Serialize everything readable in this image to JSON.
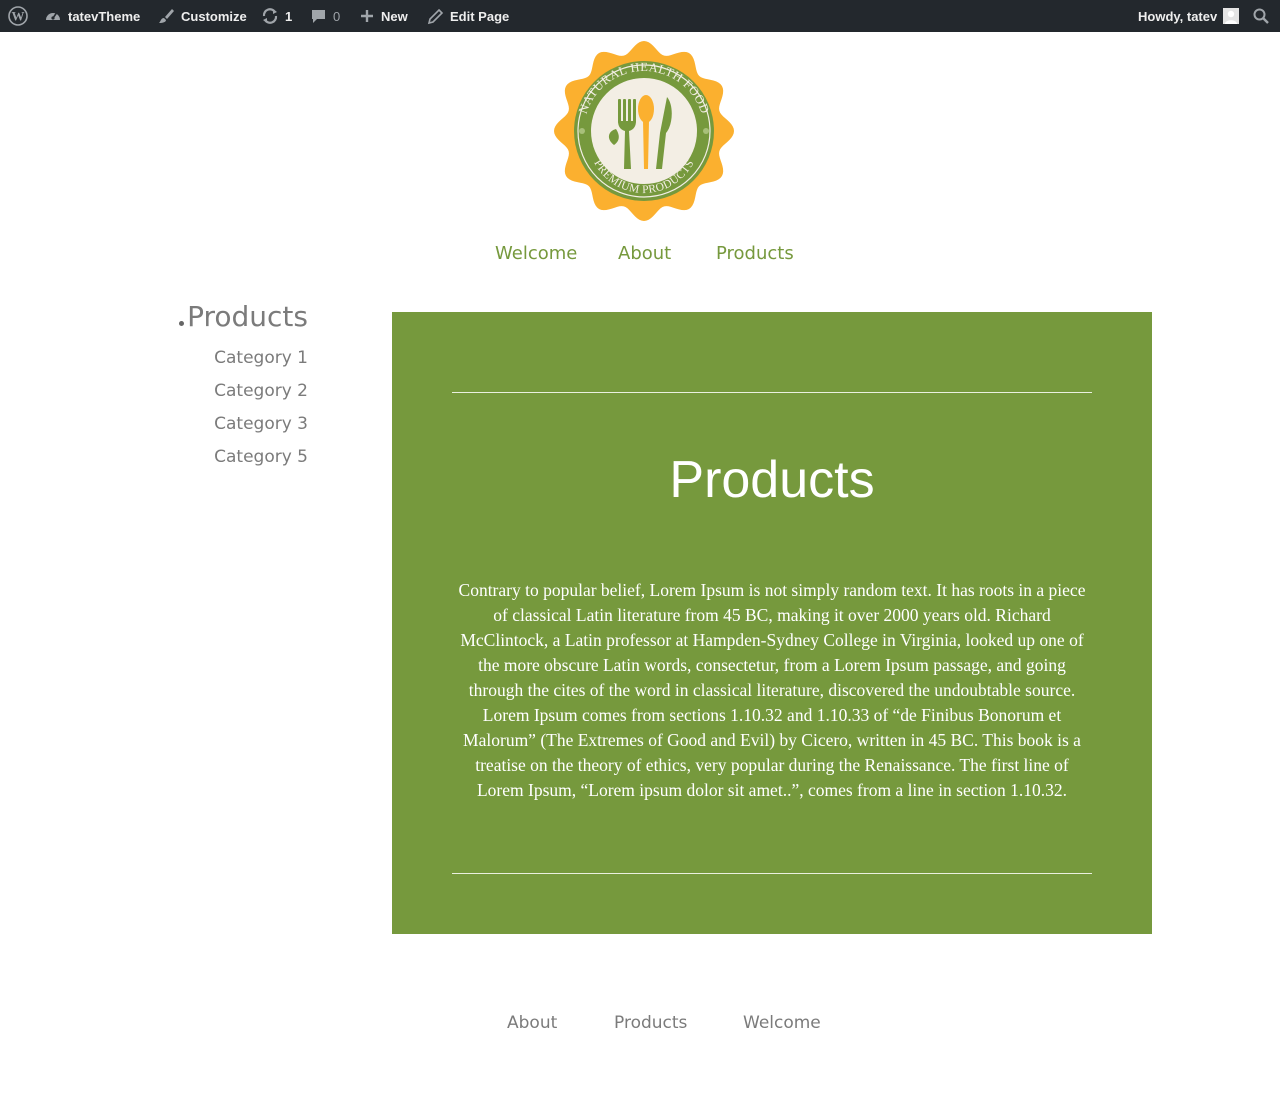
{
  "admin_bar": {
    "site_name": "tatevTheme",
    "customize_label": "Customize",
    "updates_count": "1",
    "comments_count": "0",
    "new_label": "New",
    "edit_label": "Edit Page",
    "greeting": "Howdy, tatev"
  },
  "logo": {
    "top_text": "NATURAL HEALTH FOOD",
    "bottom_text": "PREMIUM PRODUCTS",
    "colors": {
      "badge": "#fbb02f",
      "ring": "#76993d",
      "center": "#f3eee4",
      "icons": "#76993d",
      "spoon": "#fbb02f"
    }
  },
  "main_nav": {
    "items": [
      {
        "label": "Welcome"
      },
      {
        "label": "About"
      },
      {
        "label": "Products"
      }
    ]
  },
  "sidebar": {
    "title": "Products",
    "items": [
      {
        "label": "Category 1"
      },
      {
        "label": "Category 2"
      },
      {
        "label": "Category 3"
      },
      {
        "label": "Category 5"
      }
    ]
  },
  "content": {
    "title": "Products",
    "body": "Contrary to popular belief, Lorem Ipsum is not simply random text. It has roots in a piece of classical Latin literature from 45 BC, making it over 2000 years old. Richard McClintock, a Latin professor at Hampden-Sydney College in Virginia, looked up one of the more obscure Latin words, consectetur, from a Lorem Ipsum passage, and going through the cites of the word in classical literature, discovered the undoubtable source. Lorem Ipsum comes from sections 1.10.32 and 1.10.33 of “de Finibus Bonorum et Malorum” (The Extremes of Good and Evil) by Cicero, written in 45 BC. This book is a treatise on the theory of ethics, very popular during the Renaissance. The first line of Lorem Ipsum, “Lorem ipsum dolor sit amet..”, comes from a line in section 1.10.32."
  },
  "footer_nav": {
    "items": [
      {
        "label": "About"
      },
      {
        "label": "Products"
      },
      {
        "label": "Welcome"
      }
    ]
  },
  "theme": {
    "accent_green": "#76993d",
    "admin_bar_bg": "#23282d",
    "muted_text": "#7b7b7b"
  }
}
